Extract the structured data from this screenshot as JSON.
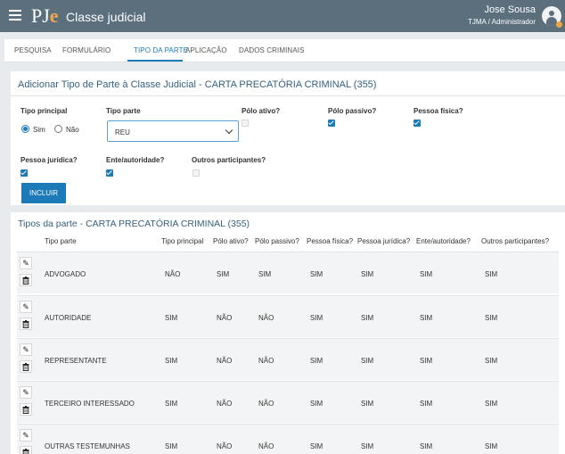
{
  "header": {
    "logo_main": "PJ",
    "logo_accent": "e",
    "title": "Classe judicial",
    "user_name": "Jose Sousa",
    "user_role": "TJMA / Administrador"
  },
  "tabs": [
    {
      "label": "PESQUISA",
      "active": false
    },
    {
      "label": "FORMULÁRIO",
      "active": false
    },
    {
      "label": "TIPO DA PARTE",
      "active": true
    },
    {
      "label": "APLICAÇÃO",
      "active": false
    },
    {
      "label": "DADOS CRIMINAIS",
      "active": false
    }
  ],
  "form": {
    "title": "Adicionar Tipo de Parte à Classe Judicial - CARTA PRECATÓRIA CRIMINAL (355)",
    "tipo_principal_label": "Tipo principal",
    "sim_label": "Sim",
    "nao_label": "Não",
    "tipo_principal_value": "Sim",
    "tipo_parte_label": "Tipo parte",
    "tipo_parte_value": "REU",
    "polo_ativo_label": "Pólo ativo?",
    "polo_ativo": false,
    "polo_passivo_label": "Pólo passivo?",
    "polo_passivo": true,
    "pessoa_fisica_label": "Pessoa física?",
    "pessoa_fisica": true,
    "pessoa_juridica_label": "Pessoa jurídica?",
    "pessoa_juridica": true,
    "ente_autoridade_label": "Ente/autoridade?",
    "ente_autoridade": true,
    "outros_label": "Outros participantes?",
    "outros": false,
    "submit_label": "INCLUIR"
  },
  "table": {
    "title": "Tipos da parte - CARTA PRECATÓRIA CRIMINAL (355)",
    "columns": [
      "Tipo parte",
      "Tipo principal",
      "Pólo ativo?",
      "Pólo passivo?",
      "Pessoa física?",
      "Pessoa jurídica?",
      "Ente/autoridade?",
      "Outros participantes?"
    ],
    "rows": [
      [
        "ADVOGADO",
        "NÃO",
        "SIM",
        "SIM",
        "SIM",
        "SIM",
        "SIM",
        "SIM"
      ],
      [
        "AUTORIDADE",
        "SIM",
        "NÃO",
        "NÃO",
        "SIM",
        "SIM",
        "SIM",
        "SIM"
      ],
      [
        "REPRESENTANTE",
        "SIM",
        "NÃO",
        "NÃO",
        "SIM",
        "SIM",
        "SIM",
        "SIM"
      ],
      [
        "TERCEIRO INTERESSADO",
        "SIM",
        "NÃO",
        "NÃO",
        "SIM",
        "SIM",
        "SIM",
        "SIM"
      ],
      [
        "OUTRAS TESTEMUNHAS",
        "SIM",
        "NÃO",
        "NÃO",
        "SIM",
        "SIM",
        "SIM",
        "SIM"
      ]
    ]
  },
  "icons": {
    "menu": "hamburger-menu-icon",
    "user": "user-avatar-icon",
    "edit": "pencil-icon",
    "delete": "trash-icon"
  },
  "colors": {
    "topbar": "#5b6f7d",
    "accent": "#1c7ab8",
    "logo_accent": "#f3a64b",
    "title_text": "#34607f"
  }
}
